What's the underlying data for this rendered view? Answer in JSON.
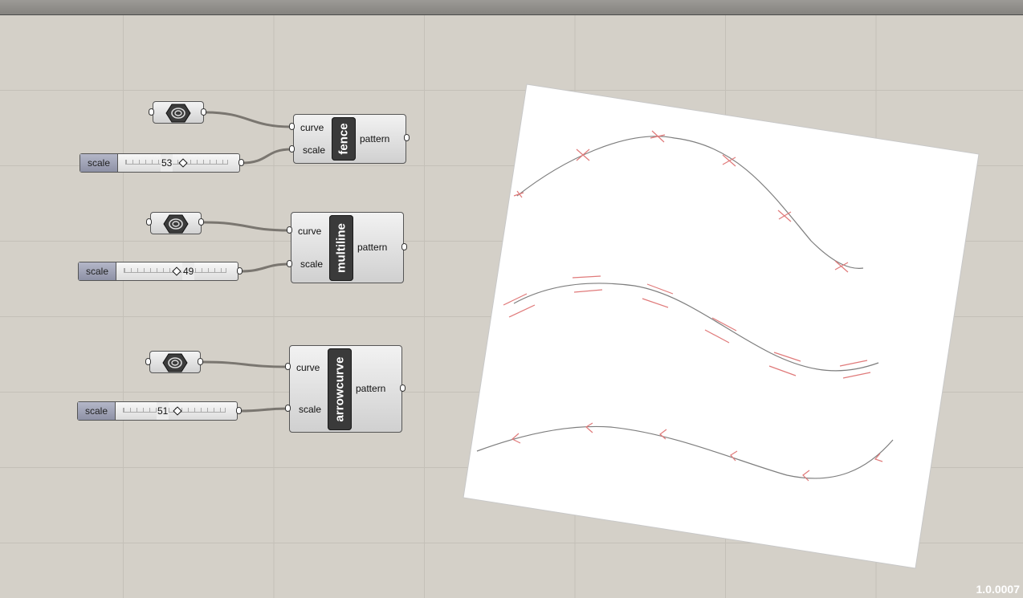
{
  "version": "1.0.0007",
  "rows": [
    {
      "component": "fence",
      "slider_label": "scale",
      "slider_value": "53",
      "slider_fraction": 0.53,
      "inputs": [
        "curve",
        "scale"
      ],
      "output": "pattern"
    },
    {
      "component": "multiline",
      "slider_label": "scale",
      "slider_value": "49",
      "slider_fraction": 0.49,
      "inputs": [
        "curve",
        "scale"
      ],
      "output": "pattern"
    },
    {
      "component": "arrowcurve",
      "slider_label": "scale",
      "slider_value": "51",
      "slider_fraction": 0.51,
      "inputs": [
        "curve",
        "scale"
      ],
      "output": "pattern"
    }
  ],
  "colors": {
    "canvas": "#d4d0c8",
    "wire": "#7a7670",
    "pattern": "#e07a7a",
    "curve": "#7e7e7e"
  }
}
